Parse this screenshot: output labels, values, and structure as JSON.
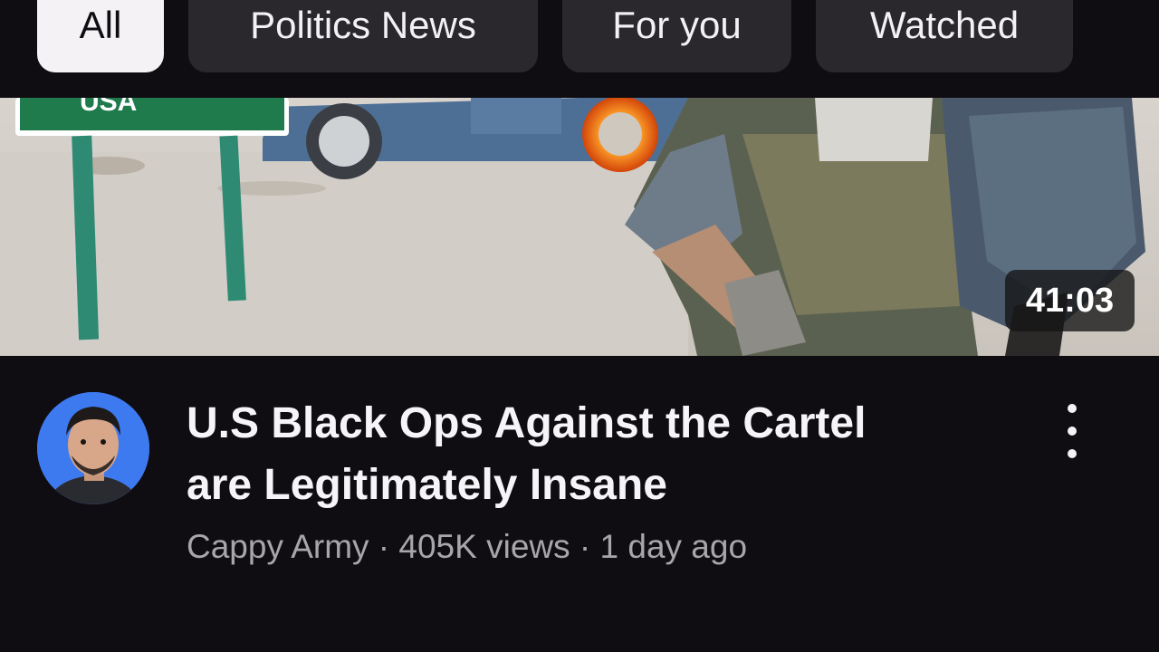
{
  "filters": {
    "chips": [
      {
        "label": "All",
        "active": true
      },
      {
        "label": "Politics News",
        "active": false
      },
      {
        "label": "For you",
        "active": false
      },
      {
        "label": "Watched",
        "active": false
      }
    ]
  },
  "video": {
    "duration": "41:03",
    "sign_text": "USA",
    "title_line1": "U.S Black Ops Against the Cartel",
    "title_line2": "are Legitimately Insane",
    "channel": "Cappy Army",
    "separator": " · ",
    "views": "405K views",
    "age": "1 day ago"
  },
  "colors": {
    "background": "#100d12",
    "chip": "#2b282d",
    "chip_active": "#f4f2f5",
    "avatar_bg": "#3d7af0"
  },
  "icons": {
    "more": "more-vert-icon"
  }
}
